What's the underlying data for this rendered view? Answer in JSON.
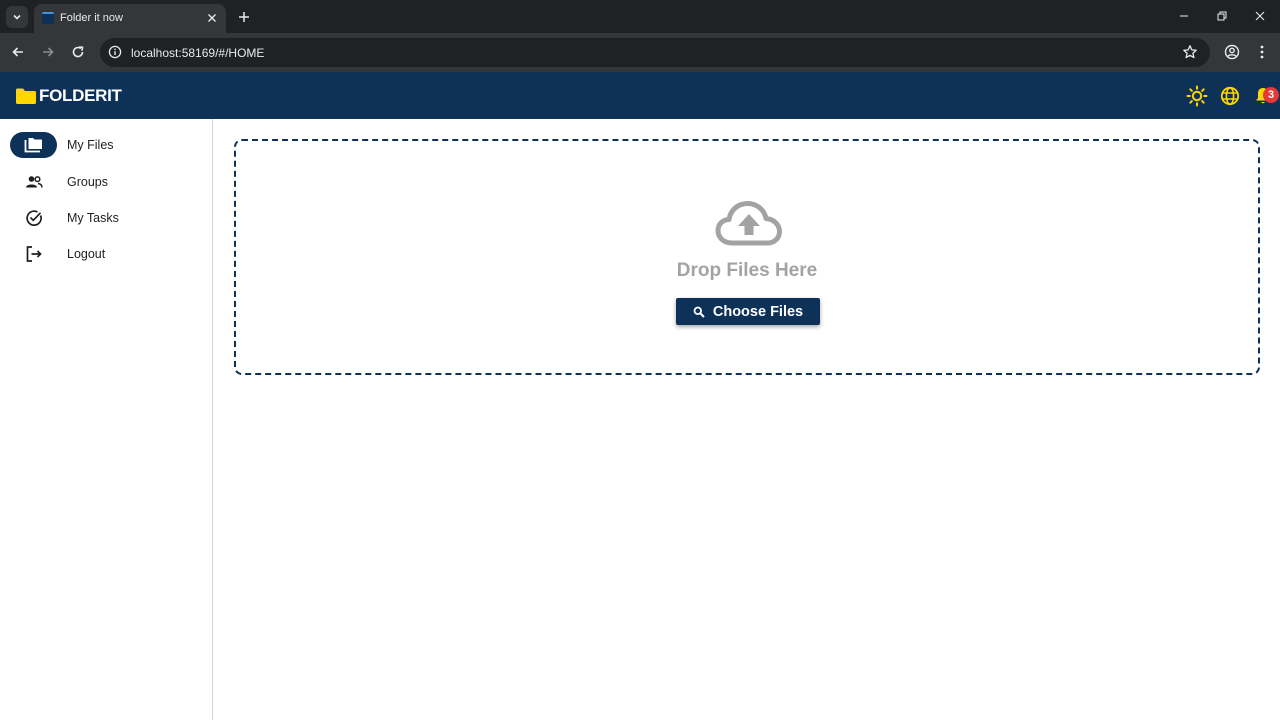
{
  "browser": {
    "tab_title": "Folder it now",
    "url": "localhost:58169/#/HOME"
  },
  "app": {
    "logo_text": "FOLDERIT",
    "notification_count": "3",
    "header_icons": [
      "sun-icon",
      "globe-icon",
      "bell-icon"
    ],
    "colors": {
      "primary": "#0d3157",
      "accent_yellow": "#ffd600",
      "badge_red": "#e53935"
    }
  },
  "sidebar": {
    "items": [
      {
        "label": "My Files",
        "icon": "folder-copy-icon",
        "active": true
      },
      {
        "label": "Groups",
        "icon": "group-icon",
        "active": false
      },
      {
        "label": "My Tasks",
        "icon": "check-circle-icon",
        "active": false
      },
      {
        "label": "Logout",
        "icon": "logout-icon",
        "active": false
      }
    ]
  },
  "dropzone": {
    "icon": "cloud-upload-icon",
    "text": "Drop Files Here",
    "button_label": "Choose Files",
    "button_icon": "search-icon"
  }
}
